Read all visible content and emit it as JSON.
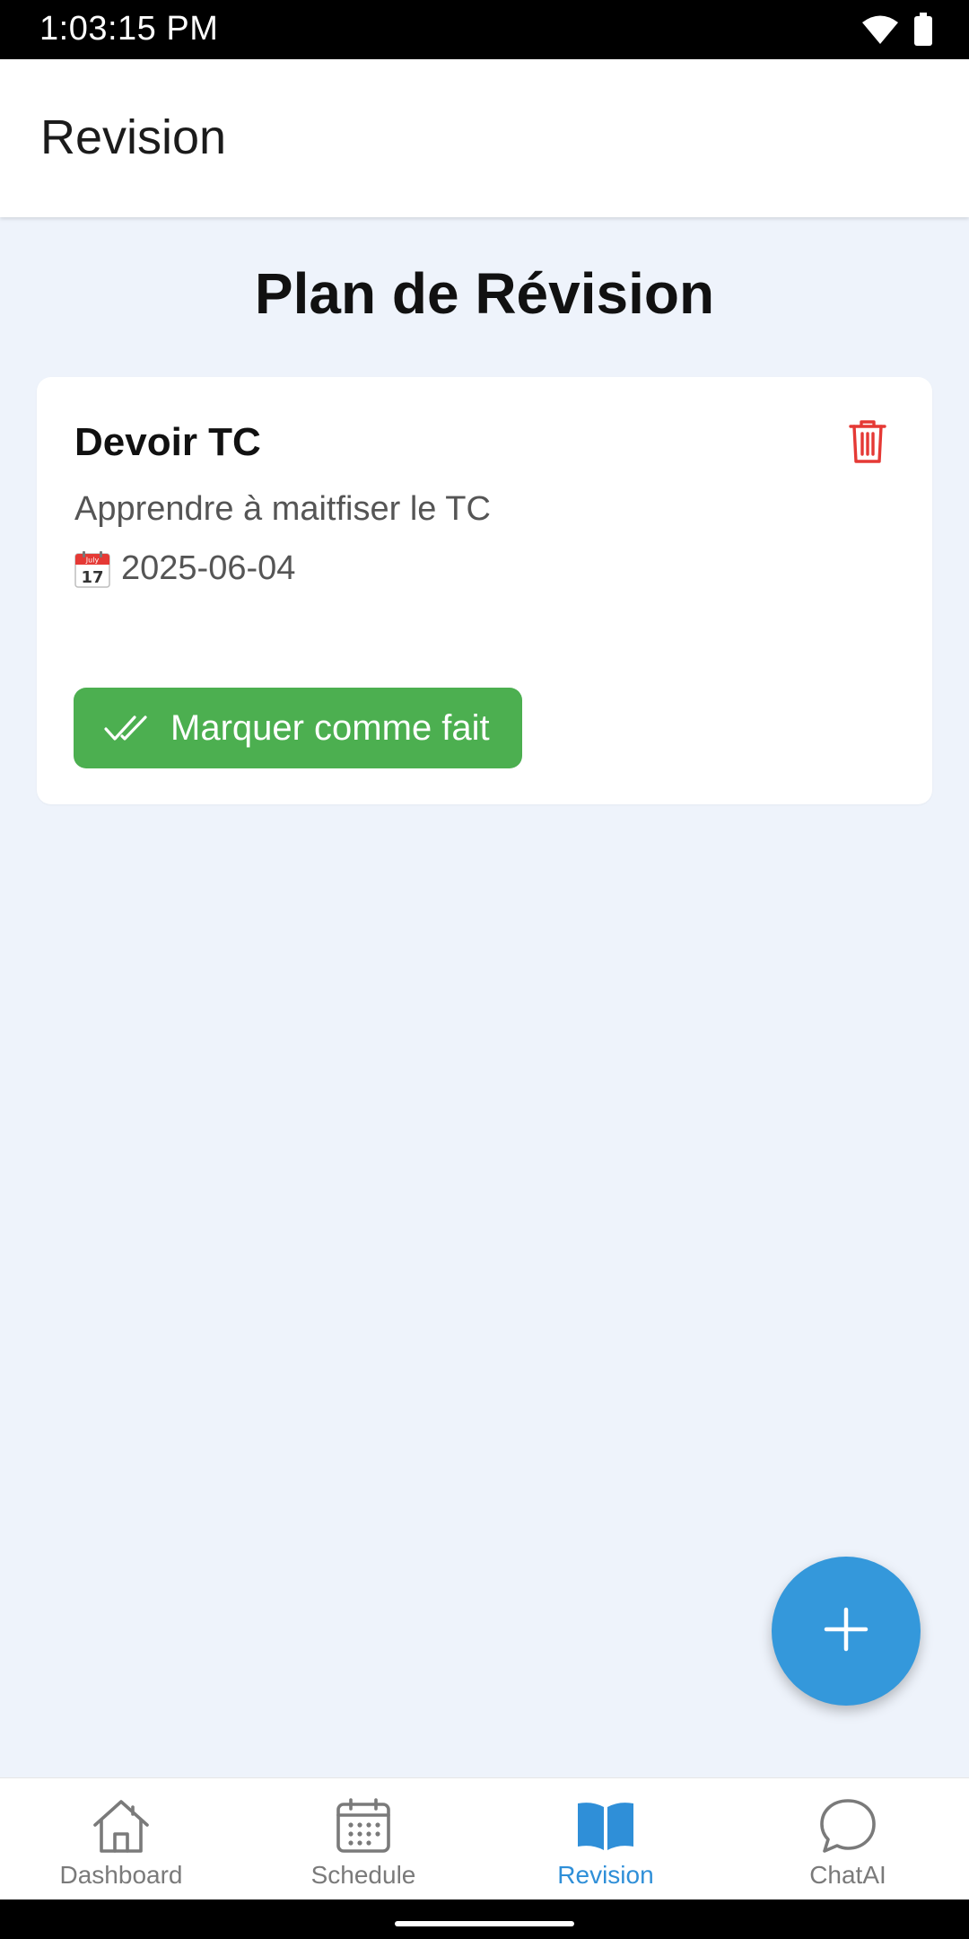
{
  "status_bar": {
    "time": "1:03:15 PM",
    "icons": [
      "wifi-icon",
      "battery-icon"
    ]
  },
  "app_bar": {
    "title": "Revision"
  },
  "page": {
    "heading": "Plan de Révision"
  },
  "revision_items": [
    {
      "title": "Devoir TC",
      "description": "Apprendre à maitfiser le TC",
      "date_icon": "calendar-icon",
      "date": "2025-06-04",
      "calendar_month": "July",
      "calendar_day": "17",
      "delete_icon": "trash-icon",
      "done_button_label": "Marquer comme fait",
      "done_icon": "double-check-icon"
    }
  ],
  "fab": {
    "icon": "plus-icon"
  },
  "bottom_nav": {
    "items": [
      {
        "label": "Dashboard",
        "icon": "home-icon",
        "active": false
      },
      {
        "label": "Schedule",
        "icon": "calendar-grid-icon",
        "active": false
      },
      {
        "label": "Revision",
        "icon": "book-open-icon",
        "active": true
      },
      {
        "label": "ChatAI",
        "icon": "chat-bubble-icon",
        "active": false
      }
    ]
  },
  "colors": {
    "background": "#eef3fb",
    "primary": "#3498db",
    "success": "#4caf50",
    "danger": "#e53935",
    "nav_active": "#2f8fd8",
    "nav_inactive": "#7a7a7a"
  }
}
